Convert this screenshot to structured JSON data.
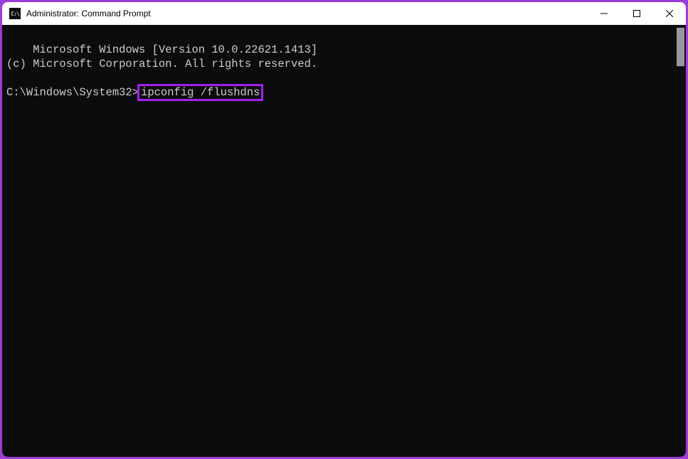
{
  "titlebar": {
    "icon_text": "C:\\",
    "title": "Administrator: Command Prompt"
  },
  "terminal": {
    "line1": "Microsoft Windows [Version 10.0.22621.1413]",
    "line2": "(c) Microsoft Corporation. All rights reserved.",
    "prompt": "C:\\Windows\\System32>",
    "command": "ipconfig /flushdns"
  }
}
